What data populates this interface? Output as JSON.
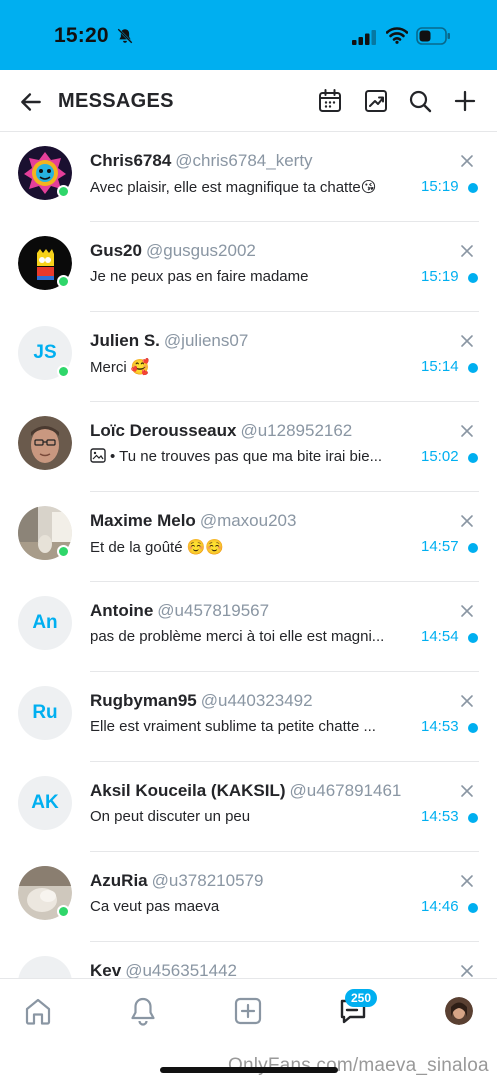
{
  "status_bar": {
    "time": "15:20"
  },
  "header": {
    "title": "MESSAGES"
  },
  "conversations": [
    {
      "name": "Chris6784",
      "handle": "@chris6784_kerty",
      "preview": "Avec plaisir, elle est magnifique ta chatte😘",
      "time": "15:19",
      "online": true,
      "unread": true,
      "avatar": "lion"
    },
    {
      "name": "Gus20",
      "handle": "@gusgus2002",
      "preview": "Je ne peux pas en faire madame",
      "time": "15:19",
      "online": true,
      "unread": true,
      "avatar": "bart"
    },
    {
      "name": "Julien S.",
      "handle": "@juliens07",
      "preview": "Merci 🥰",
      "time": "15:14",
      "online": true,
      "unread": true,
      "avatar_initials": "JS"
    },
    {
      "name": "Loïc Derousseaux",
      "handle": "@u128952162",
      "preview": "• Tu ne trouves pas que ma bite irai bie...",
      "time": "15:02",
      "online": false,
      "unread": true,
      "has_image_icon": true,
      "avatar": "face"
    },
    {
      "name": "Maxime Melo",
      "handle": "@maxou203",
      "preview": "Et de la goûté ☺️☺️",
      "time": "14:57",
      "online": true,
      "unread": true,
      "avatar": "room"
    },
    {
      "name": "Antoine",
      "handle": "@u457819567",
      "preview": "pas de problème merci à toi elle est magni...",
      "time": "14:54",
      "online": false,
      "unread": true,
      "avatar_initials": "An"
    },
    {
      "name": "Rugbyman95",
      "handle": "@u440323492",
      "preview": "Elle est vraiment sublime ta petite chatte ...",
      "time": "14:53",
      "online": false,
      "unread": true,
      "avatar_initials": "Ru"
    },
    {
      "name": "Aksil Kouceila (KAKSIL)",
      "handle": "@u467891461",
      "preview": "On peut discuter un peu",
      "time": "14:53",
      "online": false,
      "unread": true,
      "avatar_initials": "AK"
    },
    {
      "name": "AzuRia",
      "handle": "@u378210579",
      "preview": "Ca veut pas maeva",
      "time": "14:46",
      "online": true,
      "unread": true,
      "avatar": "photo"
    },
    {
      "name": "Kev",
      "handle": "@u456351442",
      "preview": "",
      "time": "",
      "online": false,
      "unread": false,
      "avatar_initials": ""
    }
  ],
  "bottom_nav": {
    "messages_badge": "250"
  },
  "watermark": "OnlyFans.com/maeva_sinaloa",
  "colors": {
    "accent": "#00aff0",
    "online": "#2fd66a",
    "text": "#242529",
    "muted": "#8a96a3"
  }
}
